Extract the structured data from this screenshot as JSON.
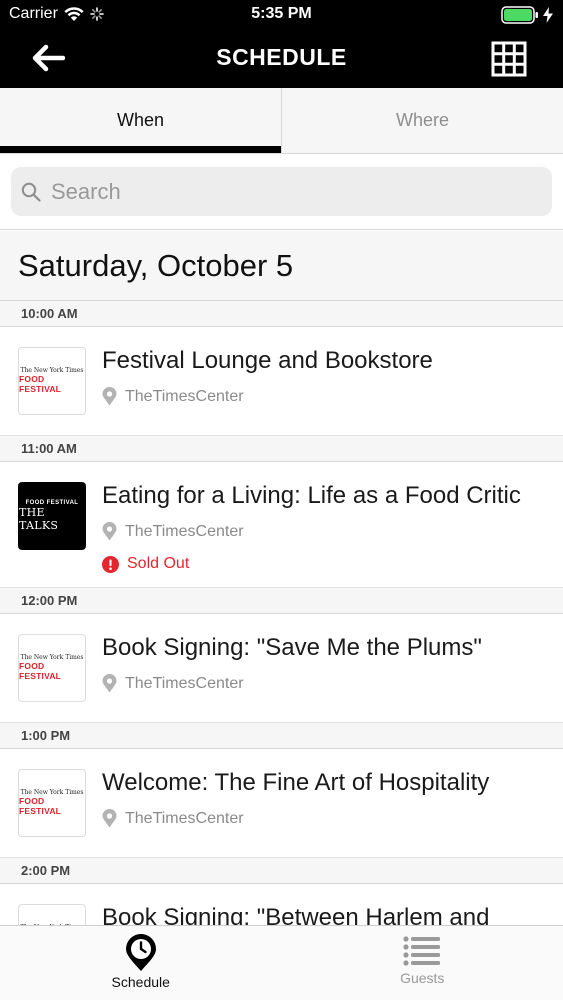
{
  "status_bar": {
    "carrier": "Carrier",
    "time": "5:35 PM"
  },
  "nav": {
    "title": "SCHEDULE"
  },
  "tabs": [
    {
      "label": "When",
      "active": true
    },
    {
      "label": "Where",
      "active": false
    }
  ],
  "search": {
    "placeholder": "Search"
  },
  "date_header": "Saturday, October 5",
  "thumbs": {
    "nyt": "The New York Times",
    "festival": "FOOD FESTIVAL",
    "talks": "THE TALKS"
  },
  "schedule": [
    {
      "time": "10:00 AM",
      "title": "Festival Lounge and Bookstore",
      "location": "TheTimesCenter",
      "thumb": "festival"
    },
    {
      "time": "11:00 AM",
      "title": "Eating for a Living: Life as a Food Critic",
      "location": "TheTimesCenter",
      "thumb": "talks",
      "status": "Sold Out"
    },
    {
      "time": "12:00 PM",
      "title": "Book Signing: \"Save Me the Plums\"",
      "location": "TheTimesCenter",
      "thumb": "festival"
    },
    {
      "time": "1:00 PM",
      "title": "Welcome: The Fine Art of Hospitality",
      "location": "TheTimesCenter",
      "thumb": "festival"
    },
    {
      "time": "2:00 PM",
      "title": "Book Signing: \"Between Harlem and",
      "thumb": "festival"
    }
  ],
  "tab_bar": [
    {
      "label": "Schedule",
      "icon": "location-pin-clock-icon",
      "active": true
    },
    {
      "label": "Guests",
      "icon": "list-icon",
      "active": false
    }
  ],
  "colors": {
    "accent": "#000000",
    "sold_out": "#e3262f",
    "festival_red": "#d9242b",
    "battery": "#4cd964"
  }
}
